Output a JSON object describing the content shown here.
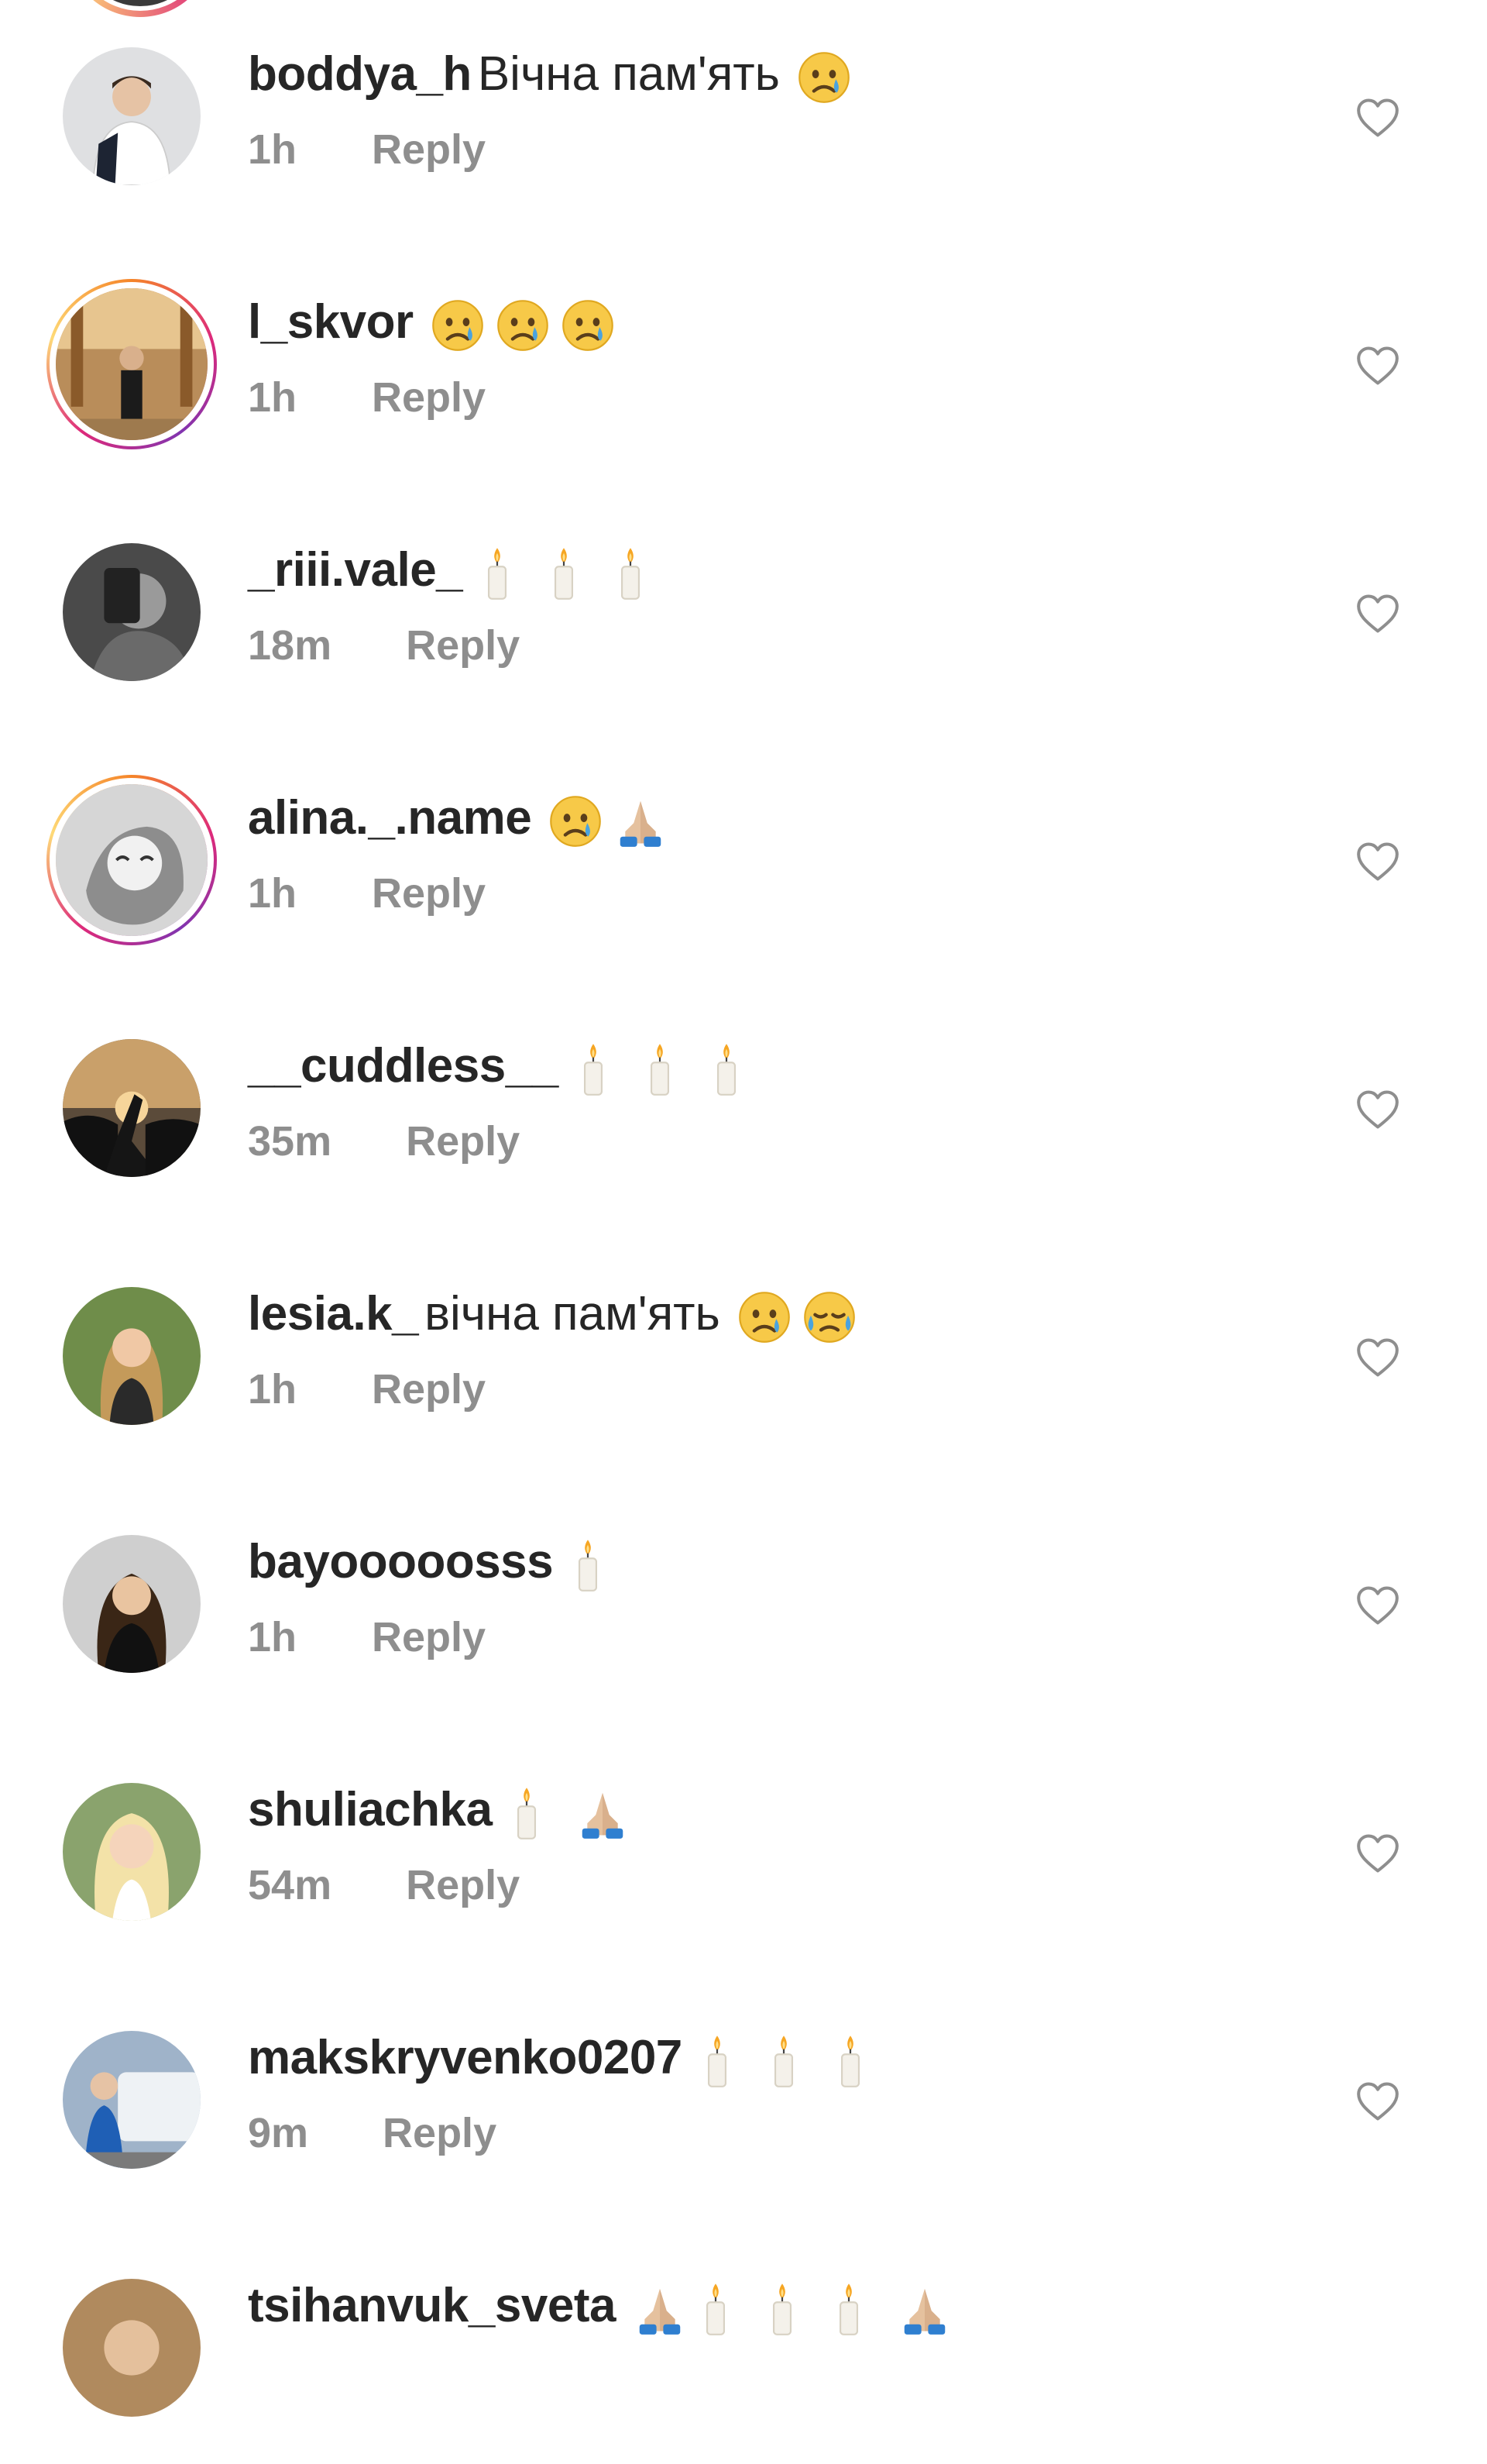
{
  "comments": [
    {
      "username": "boddya_h",
      "text": "Вічна пам'ять",
      "emojis": [
        "crying-face"
      ],
      "time": "1h",
      "reply": "Reply",
      "story": false
    },
    {
      "username": "l_skvor",
      "text": "",
      "emojis": [
        "crying-face",
        "crying-face",
        "crying-face"
      ],
      "time": "1h",
      "reply": "Reply",
      "story": true
    },
    {
      "username": "_riii.vale_",
      "text": "",
      "emojis": [
        "candle",
        "candle",
        "candle"
      ],
      "time": "18m",
      "reply": "Reply",
      "story": false
    },
    {
      "username": "alina._.name",
      "text": "",
      "emojis": [
        "crying-face",
        "folded-hands"
      ],
      "time": "1h",
      "reply": "Reply",
      "story": true
    },
    {
      "username": "__cuddless__",
      "text": "",
      "emojis": [
        "candle",
        "candle",
        "candle"
      ],
      "time": "35m",
      "reply": "Reply",
      "story": false
    },
    {
      "username": "lesia.k_",
      "text": "вічна пам'ять",
      "emojis": [
        "crying-face",
        "sad-relieved-face"
      ],
      "time": "1h",
      "reply": "Reply",
      "story": false
    },
    {
      "username": "bayooooosss",
      "text": "",
      "emojis": [
        "candle"
      ],
      "time": "1h",
      "reply": "Reply",
      "story": false
    },
    {
      "username": "shuliachka",
      "text": "",
      "emojis": [
        "candle",
        "folded-hands"
      ],
      "time": "54m",
      "reply": "Reply",
      "story": false
    },
    {
      "username": "makskryvenko0207",
      "text": "",
      "emojis": [
        "candle",
        "candle",
        "candle"
      ],
      "time": "9m",
      "reply": "Reply",
      "story": false
    },
    {
      "username": "tsihanvuk_sveta",
      "text": "",
      "emojis": [
        "folded-hands",
        "candle",
        "candle",
        "candle",
        "folded-hands"
      ],
      "time": "",
      "reply": "",
      "story": false
    }
  ],
  "colors": {
    "meta": "#8e8e8e",
    "username": "#262626",
    "heart": "#8e8e8e",
    "emoji": "#f7c948",
    "story_ring": "#dd2a7b"
  },
  "icons": {
    "like": "heart-outline-icon"
  }
}
